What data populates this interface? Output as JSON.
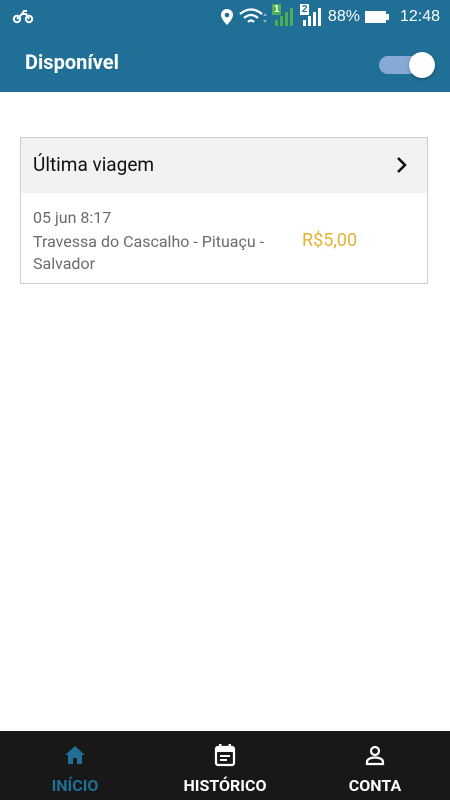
{
  "status_bar": {
    "left_icon": "motorcycle-icon",
    "icons": [
      "location-icon",
      "wifi-icon",
      "signal-sim1-icon",
      "signal-sim2-icon",
      "battery-icon"
    ],
    "sim1": "1",
    "sim2": "2",
    "battery": "88%",
    "time": "12:48"
  },
  "appbar": {
    "title": "Disponível",
    "toggle_on": true
  },
  "last_trip": {
    "title": "Última viagem",
    "date": "05 jun 8:17",
    "address": "Travessa do Cascalho - Pituaçu - Salvador",
    "price": "R$5,00"
  },
  "bottom_nav": {
    "items": [
      {
        "label": "INÍCIO",
        "icon": "home-icon",
        "active": true
      },
      {
        "label": "HISTÓRICO",
        "icon": "calendar-icon",
        "active": false
      },
      {
        "label": "CONTA",
        "icon": "person-icon",
        "active": false
      }
    ]
  },
  "colors": {
    "primary": "#1f6f96",
    "price": "#e3b330",
    "nav_background": "#181818",
    "toggle_track": "#87a9d6"
  }
}
